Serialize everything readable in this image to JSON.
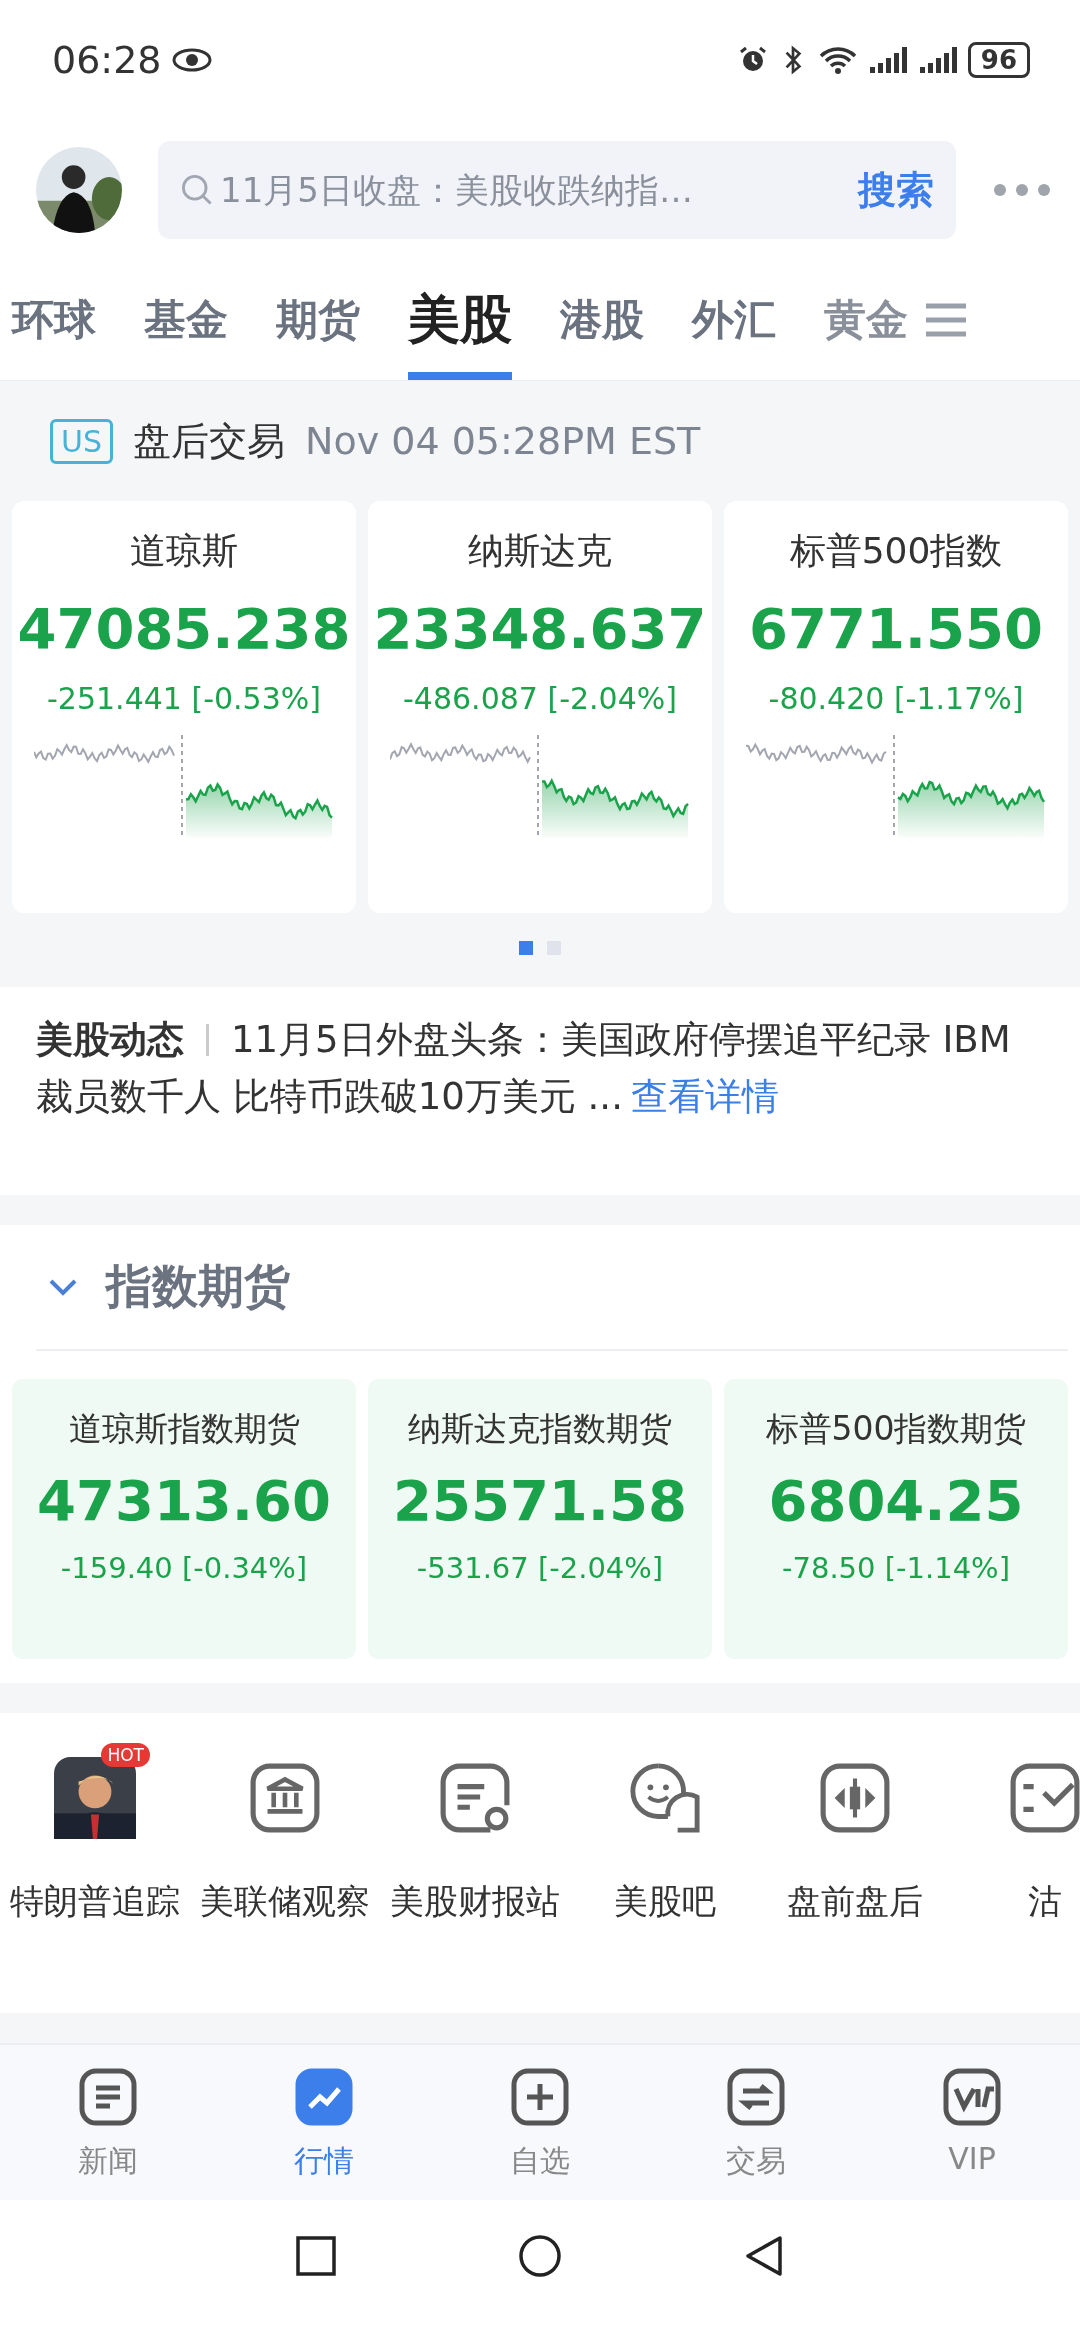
{
  "status_bar": {
    "time": "06:28",
    "battery": "96"
  },
  "header": {
    "search": {
      "placeholder": "11月5日收盘：美股收跌纳指…",
      "button": "搜索"
    }
  },
  "tabs": [
    {
      "label": "环球",
      "selected": false
    },
    {
      "label": "基金",
      "selected": false
    },
    {
      "label": "期货",
      "selected": false
    },
    {
      "label": "美股",
      "selected": true
    },
    {
      "label": "港股",
      "selected": false
    },
    {
      "label": "外汇",
      "selected": false
    },
    {
      "label": "黄金",
      "selected": false
    }
  ],
  "session": {
    "badge": "US",
    "label": "盘后交易",
    "time": "Nov 04 05:28PM EST"
  },
  "indices": [
    {
      "name": "道琼斯",
      "value": "47085.238",
      "change": "-251.441 [-0.53%]"
    },
    {
      "name": "纳斯达克",
      "value": "23348.637",
      "change": "-486.087 [-2.04%]"
    },
    {
      "name": "标普500指数",
      "value": "6771.550",
      "change": "-80.420 [-1.17%]"
    }
  ],
  "pager": [
    {
      "selected": true
    },
    {
      "selected": false
    }
  ],
  "news": {
    "tag": "美股动态",
    "text": "11月5日外盘头条：美国政府停摆追平纪录 IBM裁员数千人 比特币跌破10万美元 ...",
    "link": "查看详情"
  },
  "futures": {
    "title": "指数期货",
    "expanded": true,
    "items": [
      {
        "name": "道琼斯指数期货",
        "value": "47313.60",
        "change": "-159.40 [-0.34%]"
      },
      {
        "name": "纳斯达克指数期货",
        "value": "25571.58",
        "change": "-531.67 [-2.04%]"
      },
      {
        "name": "标普500指数期货",
        "value": "6804.25",
        "change": "-78.50 [-1.14%]"
      }
    ]
  },
  "shortcuts": [
    {
      "label": "特朗普追踪",
      "kind": "picture",
      "badge": "HOT"
    },
    {
      "label": "美联储观察",
      "kind": "icon"
    },
    {
      "label": "美股财报站",
      "kind": "icon"
    },
    {
      "label": "美股吧",
      "kind": "icon"
    },
    {
      "label": "盘前盘后",
      "kind": "icon"
    },
    {
      "label": "沽",
      "kind": "icon"
    }
  ],
  "bottom_nav": [
    {
      "label": "新闻",
      "selected": false
    },
    {
      "label": "行情",
      "selected": true
    },
    {
      "label": "自选",
      "selected": false
    },
    {
      "label": "交易",
      "selected": false
    },
    {
      "label": "VIP",
      "selected": false
    }
  ]
}
